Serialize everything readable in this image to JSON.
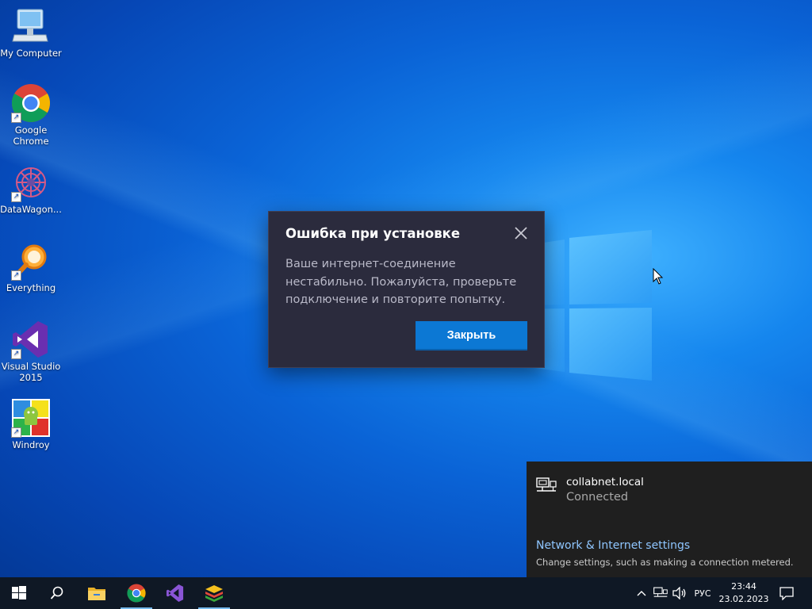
{
  "desktop": {
    "icons": [
      {
        "label": "My Computer",
        "icon": "computer-icon"
      },
      {
        "label": "Google Chrome",
        "icon": "chrome-icon"
      },
      {
        "label": "DataWagon...",
        "icon": "datawagon-icon"
      },
      {
        "label": "Everything",
        "icon": "search-magnifier-icon"
      },
      {
        "label": "Visual Studio 2015",
        "icon": "visual-studio-icon"
      },
      {
        "label": "Windroy",
        "icon": "windroy-icon"
      }
    ]
  },
  "dialog": {
    "title": "Ошибка при установке",
    "message": "Ваше интернет-соединение нестабильно. Пожалуйста, проверьте подключение и повторите попытку.",
    "button_label": "Закрыть",
    "accent_color": "#0c78d4"
  },
  "network_flyout": {
    "network_name": "collabnet.local",
    "status": "Connected",
    "settings_link": "Network & Internet settings",
    "settings_desc": "Change settings, such as making a connection metered."
  },
  "taskbar": {
    "apps": [
      {
        "name": "start",
        "icon": "windows-start-icon"
      },
      {
        "name": "search",
        "icon": "search-icon"
      },
      {
        "name": "file-explorer",
        "icon": "folder-icon"
      },
      {
        "name": "chrome",
        "icon": "chrome-icon"
      },
      {
        "name": "visual-studio",
        "icon": "visual-studio-icon"
      },
      {
        "name": "bluestacks",
        "icon": "bluestacks-icon"
      }
    ],
    "tray": {
      "language": "РУС",
      "time": "23:44",
      "date": "23.02.2023"
    }
  }
}
